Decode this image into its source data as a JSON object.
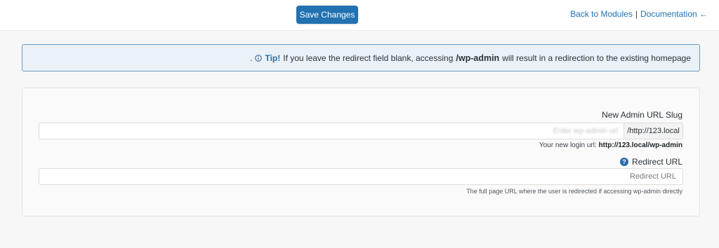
{
  "toolbar": {
    "save_label": "Save Changes",
    "back_link": "Back to Modules",
    "separator": "|",
    "docs_link": "Documentation ←"
  },
  "tip": {
    "prefix": ".",
    "label": "Tip!",
    "text_before": "If you leave the redirect field blank, accessing",
    "path": "/wp-admin",
    "text_after": "will result in a redirection to the existing homepage"
  },
  "form": {
    "slug_label": "New Admin URL Slug",
    "slug_placeholder": "Enter wp-admin url",
    "slug_value": "",
    "slug_suffix": "/http://123.local",
    "login_url_prefix": "Your new login url:",
    "login_url": "http://123.local/wp-admin",
    "redirect_label": "Redirect URL",
    "redirect_help_icon": "?",
    "redirect_placeholder": "Redirect URL",
    "redirect_value": "",
    "redirect_help": "The full page URL where the user is redirected if accessing wp-admin directly"
  },
  "colors": {
    "accent": "#2271b1",
    "tip_background": "#eaf1f7",
    "tip_border": "#6b9cc4"
  },
  "icons": {
    "tip": "info-circle-icon",
    "redirect": "question-circle-icon"
  }
}
